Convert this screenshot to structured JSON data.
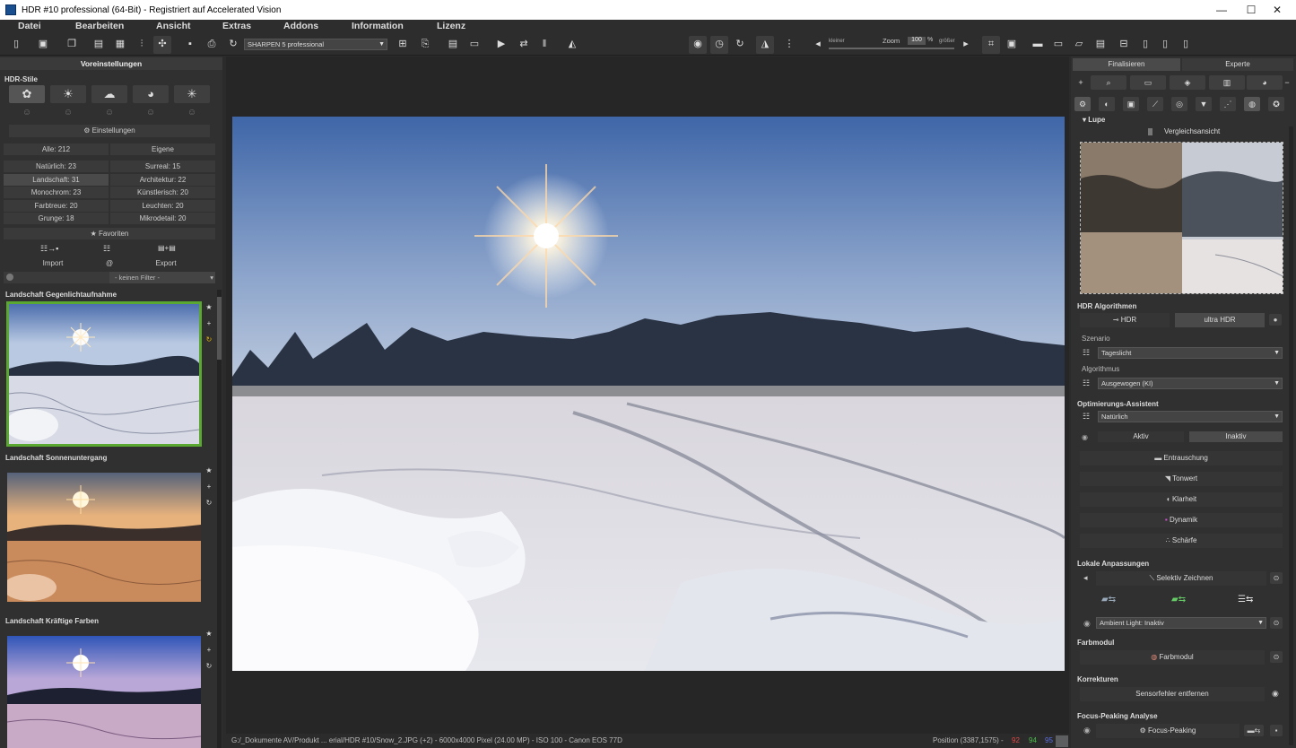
{
  "window": {
    "title": "HDR #10 professional (64-Bit) - Registriert auf Accelerated Vision",
    "minimize": "—",
    "maximize": "☐",
    "close": "✕"
  },
  "menu": [
    "Datei",
    "Bearbeiten",
    "Ansicht",
    "Extras",
    "Addons",
    "Information",
    "Lizenz"
  ],
  "toolbar": {
    "preset": "SHARPEN 5 professional",
    "zoom_label": "Zoom",
    "zoom_value": "100",
    "zoom_unit": "%",
    "smaller": "kleiner",
    "larger": "größer"
  },
  "left": {
    "panel_title": "Voreinstellungen",
    "styles_label": "HDR-Stile",
    "settings_btn": "Einstellungen",
    "all": "Alle: 212",
    "own": "Eigene",
    "categories": [
      [
        "Natürlich: 23",
        "Surreal: 15"
      ],
      [
        "Landschaft: 31",
        "Architektur: 22"
      ],
      [
        "Monochrom: 23",
        "Künstlerisch: 20"
      ],
      [
        "Farbtreue: 20",
        "Leuchten: 20"
      ],
      [
        "Grunge: 18",
        "Mikrodetail: 20"
      ]
    ],
    "favorites": "★ Favoriten",
    "import": "Import",
    "at": "@",
    "export": "Export",
    "filter": "- keinen Filter -",
    "thumbs": [
      "Landschaft Gegenlichtaufnahme",
      "Landschaft Sonnenuntergang",
      "Landschaft Kräftige Farben"
    ]
  },
  "status": {
    "path": "G:/_Dokumente AV/Produkt ... erial/HDR #10/Snow_2.JPG (+2) - 6000x4000 Pixel (24.00 MP)  - ISO 100 - Canon EOS 77D",
    "position": "Position  (3387,1575) -",
    "r": "92",
    "g": "94",
    "b": "95"
  },
  "right": {
    "tab_finalize": "Finalisieren",
    "tab_expert": "Experte",
    "lupe": "Lupe",
    "compare": "Vergleichsansicht",
    "hdr_algo_title": "HDR Algorithmen",
    "hdr": "HDR",
    "ultra_hdr": "ultra HDR",
    "scenario_label": "Szenario",
    "scenario": "Tageslicht",
    "algorithm_label": "Algorithmus",
    "algorithm": "Ausgewogen (KI)",
    "opt_title": "Optimierungs-Assistent",
    "opt_value": "Natürlich",
    "active": "Aktiv",
    "inactive": "Inaktiv",
    "opt_items": [
      "Entrauschung",
      "Tonwert",
      "Klarheit",
      "Dynamik",
      "Schärfe"
    ],
    "local_title": "Lokale Anpassungen",
    "selective": "Selektiv Zeichnen",
    "ambient": "Ambient Light: Inaktiv",
    "color_title": "Farbmodul",
    "color_btn": "Farbmodul",
    "corr_title": "Korrekturen",
    "sensor": "Sensorfehler entfernen",
    "focus_title": "Focus-Peaking Analyse",
    "focus_btn": "Focus-Peaking"
  }
}
